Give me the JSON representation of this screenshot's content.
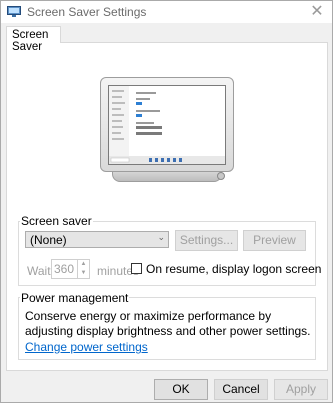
{
  "window": {
    "title": "Screen Saver Settings",
    "close_glyph": "✕"
  },
  "tabs": [
    {
      "label": "Screen Saver"
    }
  ],
  "screen_saver": {
    "group_label": "Screen saver",
    "selected": "(None)",
    "settings_label": "Settings...",
    "preview_label": "Preview",
    "wait_label": "Wait:",
    "wait_value": "360",
    "minutes_label": "minutes",
    "resume_label": "On resume, display logon screen",
    "resume_checked": false
  },
  "power": {
    "group_label": "Power management",
    "description": "Conserve energy or maximize performance by adjusting display brightness and other power settings.",
    "link_label": "Change power settings"
  },
  "footer": {
    "ok_label": "OK",
    "cancel_label": "Cancel",
    "apply_label": "Apply"
  },
  "colors": {
    "link": "#0066cc",
    "accent": "#0078d7",
    "disabled_text": "#a0a0a0"
  }
}
